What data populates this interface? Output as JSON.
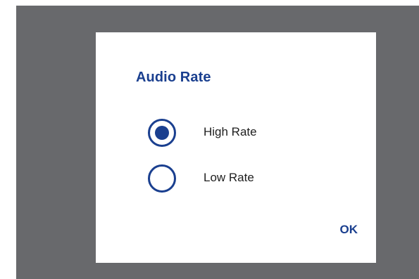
{
  "dialog": {
    "title": "Audio Rate",
    "options": [
      {
        "label": "High Rate",
        "selected": true
      },
      {
        "label": "Low Rate",
        "selected": false
      }
    ],
    "ok_label": "OK"
  },
  "colors": {
    "accent": "#1a3f8f",
    "scrim": "#68696c",
    "text": "#1e1e1e"
  }
}
